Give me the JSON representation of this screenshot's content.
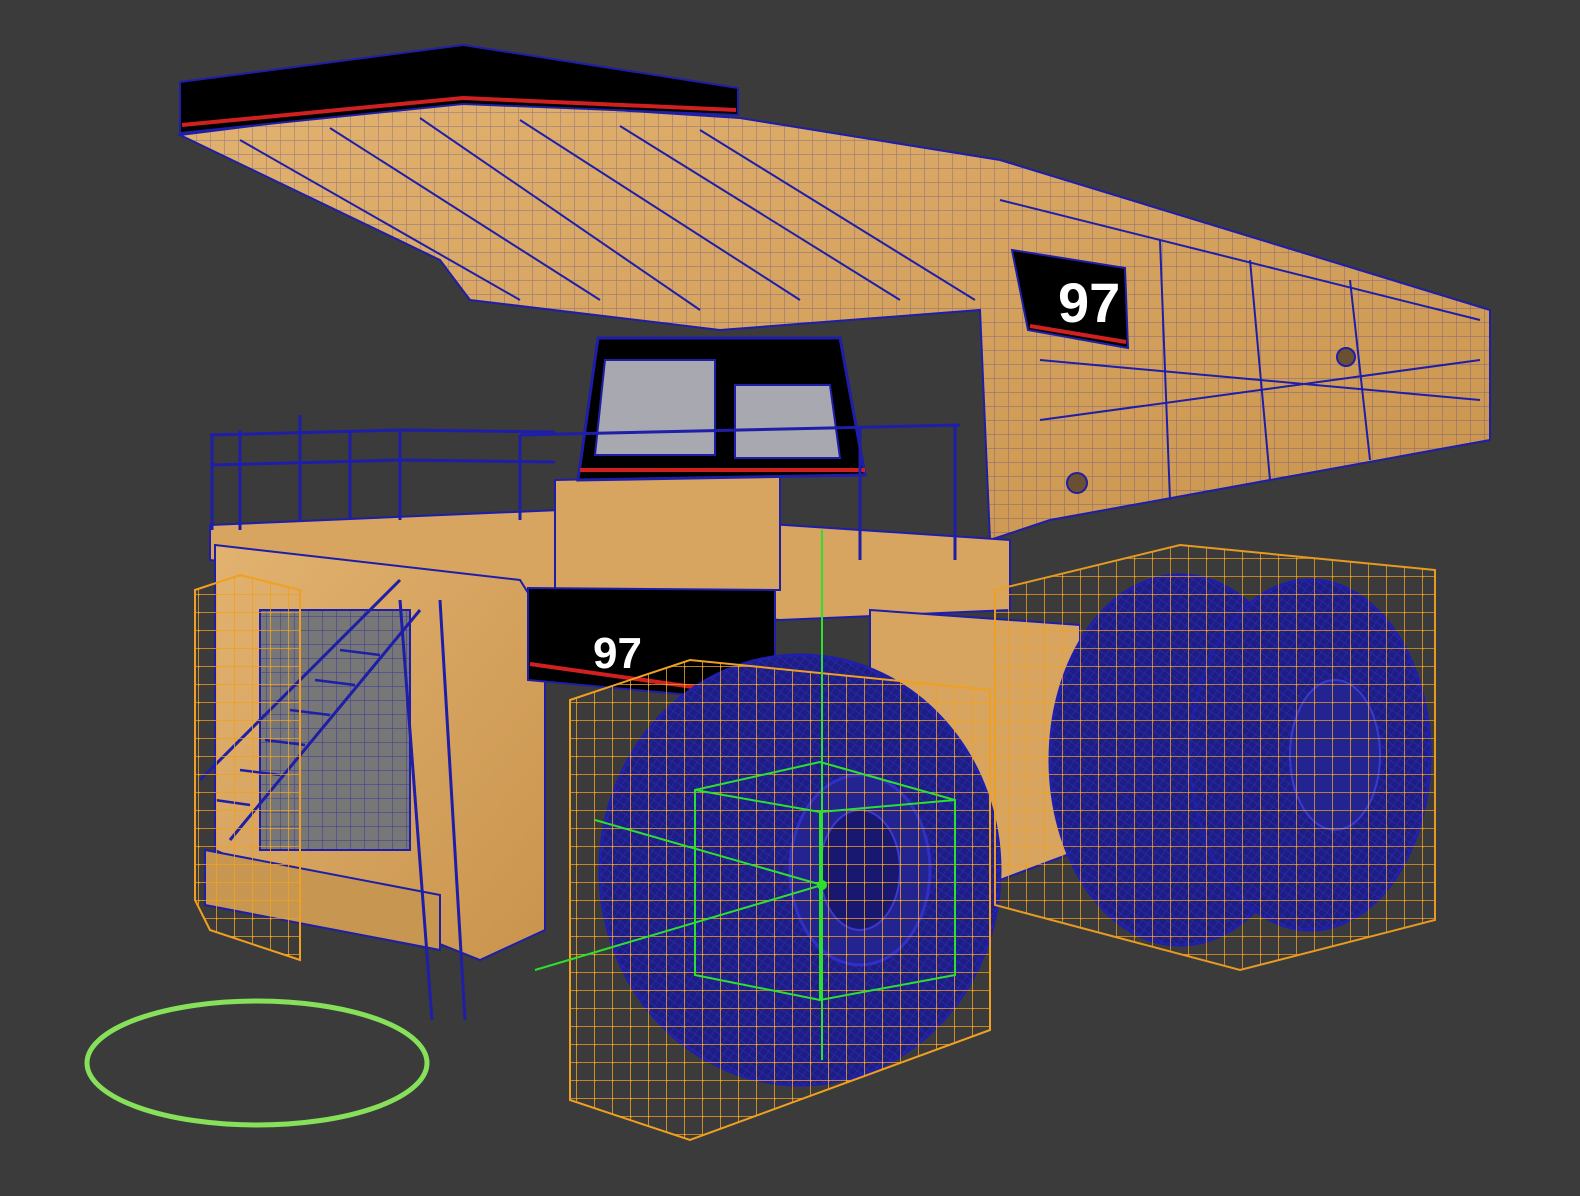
{
  "viewport": {
    "background": "#3b3b3b"
  },
  "truck": {
    "decal_body_number": "97",
    "decal_front_number": "97",
    "body_color": "#d7a560",
    "wire_color": "#1e1ea8",
    "decal_color": "#000000",
    "stripe_color": "#d02020"
  },
  "overlays": {
    "lattice_color": "#f0a020",
    "gizmo_color": "#2ee02e",
    "helper_circle_color": "#86e05a"
  },
  "icons": {
    "transform_gizmo": "move-gizmo-icon",
    "selection_circle": "circle-helper-icon"
  }
}
